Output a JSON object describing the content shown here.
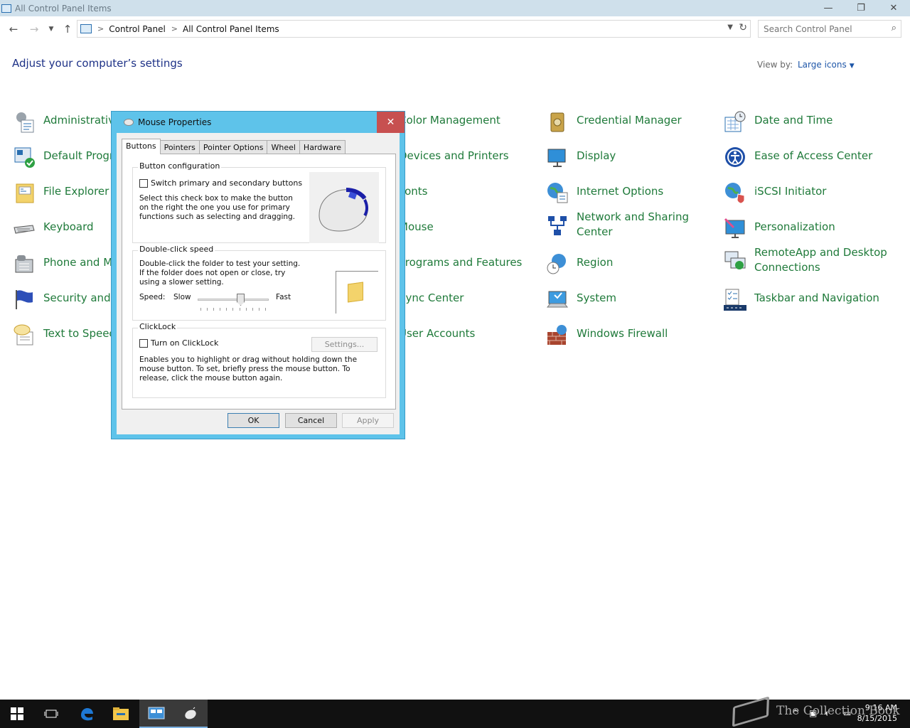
{
  "window": {
    "title": "All Control Panel Items",
    "minimize_glyph": "—",
    "restore_glyph": "❐",
    "close_glyph": "✕"
  },
  "addressbar": {
    "crumb1": "Control Panel",
    "crumb2": "All Control Panel Items",
    "separator": ">"
  },
  "search": {
    "placeholder": "Search Control Panel"
  },
  "header": {
    "title": "Adjust your computer’s settings",
    "view_by_label": "View by:",
    "view_by_value": "Large icons"
  },
  "items": [
    {
      "label": "Administrative Tools",
      "icon": "admin-tools-icon"
    },
    {
      "label": "Default Programs",
      "icon": "default-programs-icon"
    },
    {
      "label": "File Explorer Options",
      "icon": "file-explorer-options-icon"
    },
    {
      "label": "Keyboard",
      "icon": "keyboard-icon"
    },
    {
      "label": "Phone and Modem",
      "icon": "phone-modem-icon"
    },
    {
      "label": "Security and Maintenance",
      "icon": "security-flag-icon"
    },
    {
      "label": "Text to Speech",
      "icon": "speech-icon"
    },
    {
      "label": "Color Management",
      "icon": "color-management-icon"
    },
    {
      "label": "Devices and Printers",
      "icon": "devices-printers-icon"
    },
    {
      "label": "Fonts",
      "icon": "fonts-icon"
    },
    {
      "label": "Mouse",
      "icon": "mouse-icon"
    },
    {
      "label": "Programs and Features",
      "icon": "programs-features-icon"
    },
    {
      "label": "Sync Center",
      "icon": "sync-center-icon"
    },
    {
      "label": "User Accounts",
      "icon": "user-accounts-icon"
    },
    {
      "label": "Credential Manager",
      "icon": "credential-manager-icon"
    },
    {
      "label": "Display",
      "icon": "display-icon"
    },
    {
      "label": "Internet Options",
      "icon": "internet-options-icon"
    },
    {
      "label": "Network and Sharing Center",
      "icon": "network-sharing-icon"
    },
    {
      "label": "Region",
      "icon": "region-icon"
    },
    {
      "label": "System",
      "icon": "system-icon"
    },
    {
      "label": "Windows Firewall",
      "icon": "firewall-icon"
    },
    {
      "label": "Date and Time",
      "icon": "date-time-icon"
    },
    {
      "label": "Ease of Access Center",
      "icon": "ease-of-access-icon"
    },
    {
      "label": "iSCSI Initiator",
      "icon": "iscsi-icon"
    },
    {
      "label": "Personalization",
      "icon": "personalization-icon"
    },
    {
      "label": "RemoteApp and Desktop Connections",
      "icon": "remoteapp-icon"
    },
    {
      "label": "Taskbar and Navigation",
      "icon": "taskbar-navigation-icon"
    }
  ],
  "dialog": {
    "title": "Mouse Properties",
    "close_glyph": "✕",
    "tabs": [
      "Buttons",
      "Pointers",
      "Pointer Options",
      "Wheel",
      "Hardware"
    ],
    "button_config": {
      "title": "Button configuration",
      "checkbox": "Switch primary and secondary buttons",
      "description": "Select this check box to make the button on the right the one you use for primary functions such as selecting and dragging."
    },
    "double_click": {
      "title": "Double-click speed",
      "description": "Double-click the folder to test your setting. If the folder does not open or close, try using a slower setting.",
      "speed_label": "Speed:",
      "slow_label": "Slow",
      "fast_label": "Fast",
      "speed_fraction": 0.6
    },
    "clicklock": {
      "title": "ClickLock",
      "checkbox": "Turn on ClickLock",
      "settings_button": "Settings...",
      "description": "Enables you to highlight or drag without holding down the mouse button. To set, briefly press the mouse button. To release, click the mouse button again."
    },
    "ok": "OK",
    "cancel": "Cancel",
    "apply": "Apply"
  },
  "taskbar": {
    "time": "9:16 AM",
    "date": "8/15/2015",
    "watermark": "The Collection Book"
  }
}
